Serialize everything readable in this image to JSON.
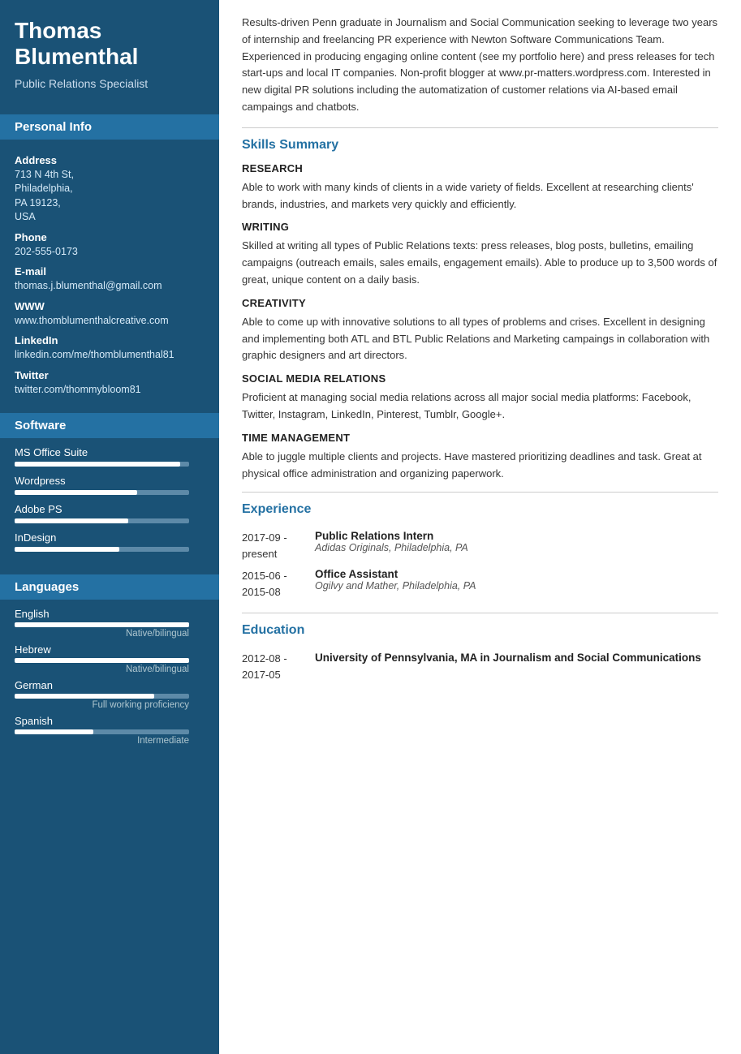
{
  "sidebar": {
    "name": "Thomas Blumenthal",
    "title": "Public Relations Specialist",
    "sections": {
      "personal_info": "Personal Info",
      "software": "Software",
      "languages": "Languages"
    },
    "personal": {
      "address_label": "Address",
      "address_value": "713 N 4th St,\nPhiladelphia,\nPA 19123,\nUSA",
      "phone_label": "Phone",
      "phone_value": "202-555-0173",
      "email_label": "E-mail",
      "email_value": "thomas.j.blumenthal@gmail.com",
      "www_label": "WWW",
      "www_value": "www.thomblumenthalcreative.com",
      "linkedin_label": "LinkedIn",
      "linkedin_value": "linkedin.com/me/thomblumenthal81",
      "twitter_label": "Twitter",
      "twitter_value": "twitter.com/thommybloom81"
    },
    "software": [
      {
        "name": "MS Office Suite",
        "fill_pct": 95
      },
      {
        "name": "Wordpress",
        "fill_pct": 70
      },
      {
        "name": "Adobe PS",
        "fill_pct": 65
      },
      {
        "name": "InDesign",
        "fill_pct": 60
      }
    ],
    "languages": [
      {
        "name": "English",
        "fill_pct": 100,
        "level": "Native/bilingual"
      },
      {
        "name": "Hebrew",
        "fill_pct": 100,
        "level": "Native/bilingual"
      },
      {
        "name": "German",
        "fill_pct": 80,
        "level": "Full working proficiency"
      },
      {
        "name": "Spanish",
        "fill_pct": 45,
        "level": "Intermediate"
      }
    ]
  },
  "main": {
    "summary": "Results-driven Penn graduate in Journalism and Social Communication seeking to leverage two years of internship and freelancing PR experience with Newton Software Communications Team. Experienced in producing engaging online content (see my portfolio here) and press releases for tech start-ups and local IT companies. Non-profit blogger at www.pr-matters.wordpress.com. Interested in new digital PR solutions including the automatization of customer relations via AI-based email campaings and chatbots.",
    "skills_title": "Skills Summary",
    "skills": [
      {
        "name": "RESEARCH",
        "desc": "Able to work with many kinds of clients in a wide variety of fields. Excellent at researching clients' brands, industries, and markets very quickly and efficiently."
      },
      {
        "name": "WRITING",
        "desc": "Skilled at writing all types of Public Relations texts: press releases, blog posts, bulletins, emailing campaigns (outreach emails, sales emails, engagement emails). Able to produce up to 3,500 words of great, unique content on a daily basis."
      },
      {
        "name": "CREATIVITY",
        "desc": "Able to come up with innovative solutions to all types of problems and crises. Excellent in designing and implementing both ATL and BTL Public Relations and Marketing campaings in collaboration with graphic designers and art directors."
      },
      {
        "name": "SOCIAL MEDIA RELATIONS",
        "desc": "Proficient at managing social media relations across all major social media platforms: Facebook, Twitter, Instagram, LinkedIn, Pinterest, Tumblr, Google+."
      },
      {
        "name": "TIME MANAGEMENT",
        "desc": "Able to juggle multiple clients and projects. Have mastered prioritizing deadlines and task. Great at physical office administration and organizing paperwork."
      }
    ],
    "experience_title": "Experience",
    "experience": [
      {
        "date": "2017-09 - present",
        "job_title": "Public Relations Intern",
        "company": "Adidas Originals, Philadelphia, PA"
      },
      {
        "date": "2015-06 - 2015-08",
        "job_title": "Office Assistant",
        "company": "Ogilvy and Mather, Philadelphia, PA"
      }
    ],
    "education_title": "Education",
    "education": [
      {
        "date": "2012-08 - 2017-05",
        "degree": "University of Pennsylvania, MA in Journalism and Social Communications"
      }
    ]
  }
}
